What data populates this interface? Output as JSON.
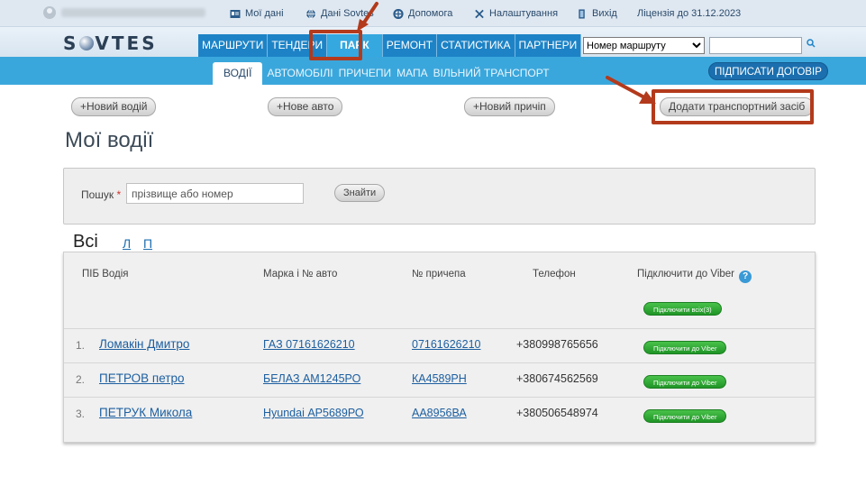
{
  "topbar": {
    "links": [
      {
        "label": "Мої дані",
        "icon": "profile-card-icon"
      },
      {
        "label": "Дані Sovtes",
        "icon": "globe-icon"
      },
      {
        "label": "Допомога",
        "icon": "lifebuoy-icon"
      },
      {
        "label": "Налаштування",
        "icon": "tools-icon"
      },
      {
        "label": "Вихід",
        "icon": "exit-door-icon"
      }
    ],
    "license": "Ліцензія до 31.12.2023"
  },
  "header": {
    "logo_left": "S",
    "logo_right": "VTES",
    "nav": [
      "МАРШРУТИ",
      "ТЕНДЕРИ",
      "ПАРК",
      "РЕМОНТ",
      "СТАТИСТИКА",
      "ПАРТНЕРИ"
    ],
    "active_nav": "ПАРК",
    "route_select": "Номер маршруту",
    "route_input": ""
  },
  "subnav": {
    "items": [
      "ВОДІЇ",
      "АВТОМОБІЛІ",
      "ПРИЧЕПИ",
      "МАПА",
      "ВІЛЬНИЙ ТРАНСПОРТ"
    ],
    "active": "ВОДІЇ",
    "sign_contract": "ПІДПИСАТИ ДОГОВІР"
  },
  "actions": {
    "new_driver": "+Новий водій",
    "new_car": "+Нове авто",
    "new_trailer": "+Новий причіп",
    "add_vehicle": "Додати транспортний засіб"
  },
  "page_title": "Мої водії",
  "search": {
    "label": "Пошук",
    "required_mark": "*",
    "placeholder": "прізвище або номер",
    "button": "Знайти"
  },
  "filters": {
    "all": "Всі",
    "letters": [
      "Л",
      "П"
    ]
  },
  "table": {
    "headers": {
      "name": "ПІБ Водія",
      "car": "Марка і № авто",
      "trailer": "№ причепа",
      "phone": "Телефон",
      "viber": "Підключити до Viber",
      "help": "?"
    },
    "connect_all": "Підключити всіх(3)",
    "rows": [
      {
        "num": "1.",
        "name": "Ломакін Дмитро",
        "car": "ГАЗ 07161626210",
        "trailer": "07161626210",
        "phone": "+380998765656",
        "viber": "Підключити до Viber"
      },
      {
        "num": "2.",
        "name": "ПЕТРОВ петро",
        "car": "БЕЛАЗ АМ1245РО",
        "trailer": "КА4589РН",
        "phone": "+380674562569",
        "viber": "Підключити до Viber"
      },
      {
        "num": "3.",
        "name": "ПЕТРУК Микола",
        "car": "Hyundai АР5689РО",
        "trailer": "АА8956ВА",
        "phone": "+380506548974",
        "viber": "Підключити до Viber"
      }
    ]
  },
  "colors": {
    "nav_blue": "#1d83c6",
    "subnav_blue": "#3aa7dc",
    "highlight_red": "#b33a1c",
    "viber_green": "#2aa532"
  }
}
